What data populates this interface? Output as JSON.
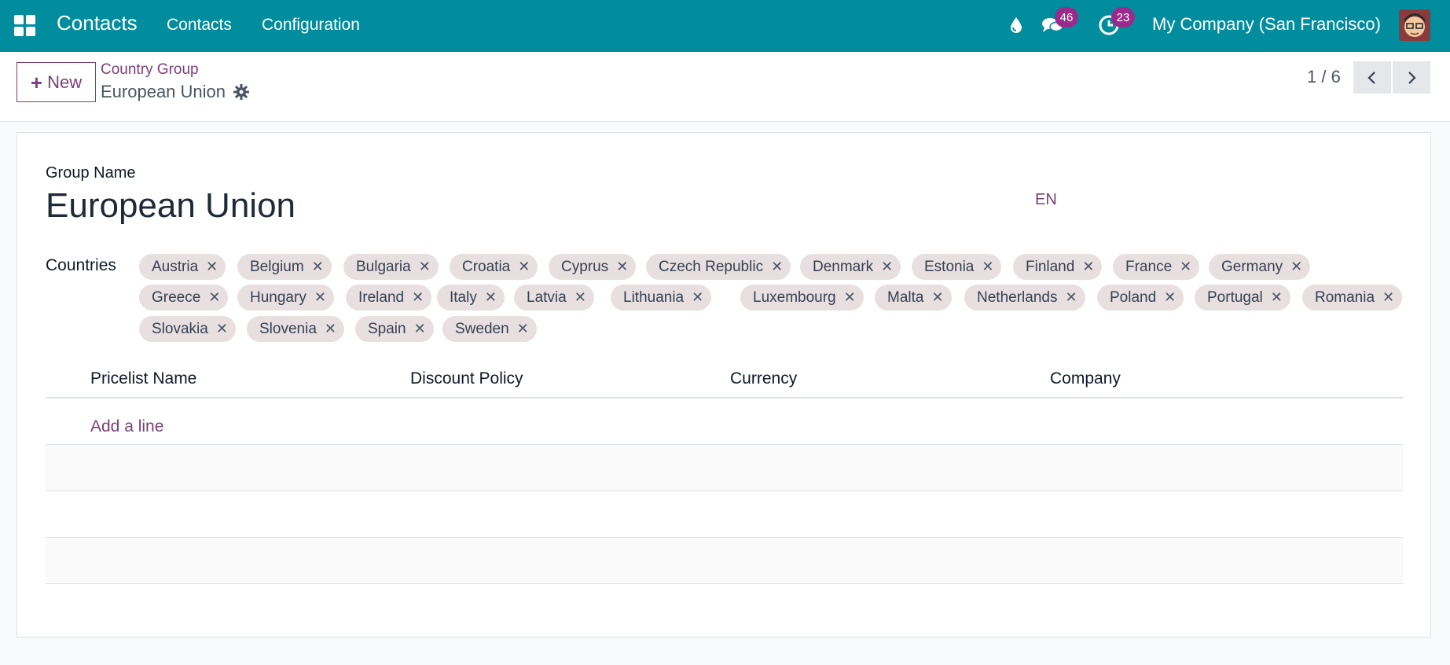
{
  "navbar": {
    "brand": "Contacts",
    "links": [
      "Contacts",
      "Configuration"
    ],
    "messages_count": "46",
    "activities_count": "23",
    "company": "My Company (San Francisco)"
  },
  "control_panel": {
    "new_label": "New",
    "breadcrumb_parent": "Country Group",
    "breadcrumb_current": "European Union",
    "pager": "1 / 6"
  },
  "form": {
    "group_name_label": "Group Name",
    "group_name": "European Union",
    "lang": "EN",
    "countries_label": "Countries",
    "countries": [
      "Austria",
      "Belgium",
      "Bulgaria",
      "Croatia",
      "Cyprus",
      "Czech Republic",
      "Denmark",
      "Estonia",
      "Finland",
      "France",
      "Germany",
      "Greece",
      "Hungary",
      "Ireland",
      "Italy",
      "Latvia",
      "Lithuania",
      "Luxembourg",
      "Malta",
      "Netherlands",
      "Poland",
      "Portugal",
      "Romania",
      "Slovakia",
      "Slovenia",
      "Spain",
      "Sweden"
    ],
    "table": {
      "columns": [
        "Pricelist Name",
        "Discount Policy",
        "Currency",
        "Company"
      ],
      "add_line": "Add a line"
    }
  },
  "colors": {
    "navbar": "#018d9e",
    "accent": "#7c3f79",
    "badge": "#9b2a8d",
    "tag_bg": "#e7dfe0"
  }
}
